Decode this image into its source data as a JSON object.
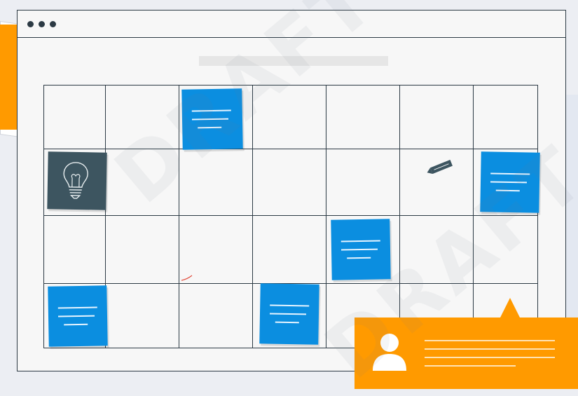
{
  "window": {
    "controls": [
      "dot-1",
      "dot-2",
      "dot-3"
    ]
  },
  "board": {
    "columns": 7,
    "rows": 4,
    "idea_card_icon": "lightbulb-icon",
    "tool_icon": "pencil-icon"
  },
  "comment": {
    "avatar_icon": "user-avatar-icon"
  },
  "watermark": {
    "text": "DRAFT"
  },
  "colors": {
    "note_blue": "#0b8ee0",
    "accent_orange": "#ff9a00",
    "dark_slate": "#3d5560",
    "outline": "#2c3a44"
  }
}
